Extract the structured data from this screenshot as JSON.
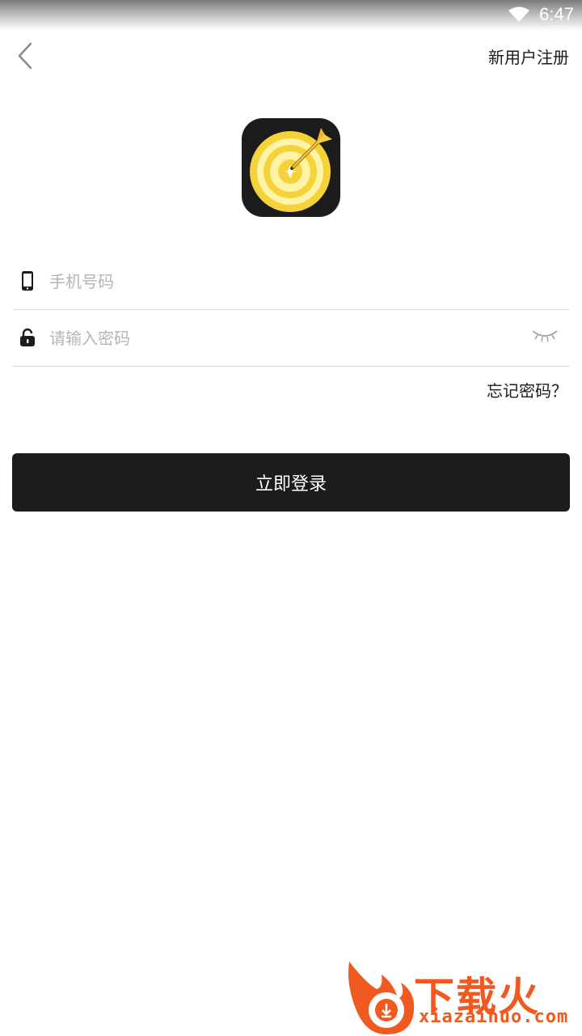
{
  "status_bar": {
    "time": "6:47",
    "icons": [
      "wifi-icon"
    ]
  },
  "header": {
    "back_icon": "chevron-left-icon",
    "register_label": "新用户注册"
  },
  "logo": {
    "icon": "dartboard-target-icon",
    "colors": {
      "background": "#1c1c1c",
      "gold": "#f6d23a",
      "pale_gold": "#fff3a8"
    }
  },
  "form": {
    "phone": {
      "icon": "phone-icon",
      "value": "",
      "placeholder": "手机号码"
    },
    "password": {
      "icon": "lock-icon",
      "value": "",
      "placeholder": "请输入密码",
      "toggle_icon": "eye-closed-icon"
    },
    "forgot_label": "忘记密码？",
    "submit_label": "立即登录"
  },
  "watermark": {
    "name": "下载火",
    "url": "xiazaihuo.com",
    "color": "#f0591f"
  },
  "colors": {
    "primary_button": "#1c1c1c",
    "divider": "#dedede",
    "placeholder": "#b5b5b5"
  }
}
